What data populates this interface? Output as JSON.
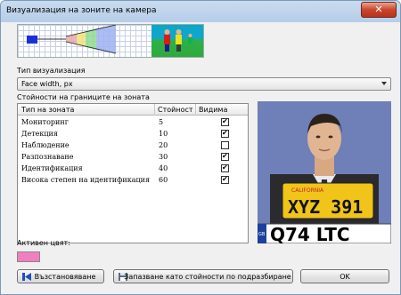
{
  "window": {
    "title": "Визуализация на зоните на камера",
    "close_label": "✕"
  },
  "visualization_type": {
    "label": "Тип визуализация",
    "selected": "Face width, px"
  },
  "zones": {
    "section_label": "Стойности на границите на зоната",
    "columns": [
      "Тип на зоната",
      "Стойност",
      "Видима"
    ],
    "rows": [
      {
        "name": "Мониторинг",
        "value": "5",
        "visible": true
      },
      {
        "name": "Детекция",
        "value": "10",
        "visible": true
      },
      {
        "name": "Наблюдение",
        "value": "20",
        "visible": false
      },
      {
        "name": "Разпознаване",
        "value": "30",
        "visible": true
      },
      {
        "name": "Идентификация",
        "value": "40",
        "visible": true
      },
      {
        "name": "Висока степен на идентификация",
        "value": "60",
        "visible": true
      }
    ]
  },
  "preview": {
    "plate_small_top": "CALIFORNIA",
    "plate_small": "XYZ 391",
    "plate_large_prefix": "GB",
    "plate_large": "Q74 LTC"
  },
  "active_color": {
    "label": "Активен цвят:",
    "color": "#f07fc0"
  },
  "buttons": {
    "restore": "Възстановяване",
    "save_default": "Запазване като стойности по подразбиране",
    "ok": "OK"
  },
  "colors": {
    "title_bar": "#c9dbef",
    "close": "#c9452c",
    "preview_bg": "#6f7fb7"
  }
}
